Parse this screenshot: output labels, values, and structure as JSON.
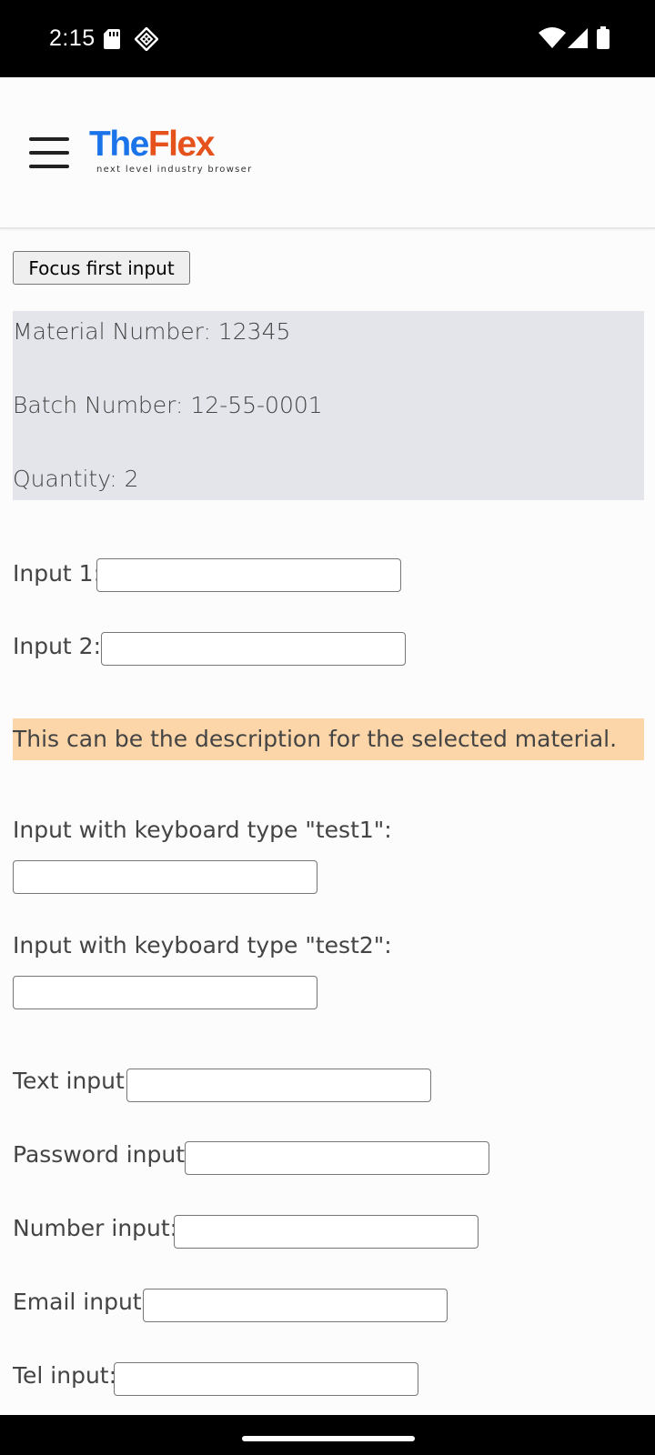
{
  "status_bar": {
    "time": "2:15",
    "icons": [
      "sd-card-icon",
      "diamond-icon",
      "wifi-icon",
      "signal-icon",
      "battery-icon"
    ]
  },
  "header": {
    "logo_part1": "The",
    "logo_part2": "Flex",
    "tagline": "next level industry browser",
    "colors": {
      "logo_blue": "#1a73e8",
      "logo_orange": "#e5521c"
    }
  },
  "main": {
    "focus_button_label": "Focus first input",
    "info": {
      "material": "Material Number: 12345",
      "batch": "Batch Number: 12-55-0001",
      "quantity": "Quantity: 2"
    },
    "input1_label": "Input 1:",
    "input2_label": "Input 2:",
    "description": "This can be the description for the selected material.",
    "kb_test1_label": "Input with keyboard type \"test1\":",
    "kb_test2_label": "Input with keyboard type \"test2\":",
    "text_label": "Text input:",
    "password_label": "Password input:",
    "number_label": "Number input:",
    "email_label": "Email input:",
    "tel_label": "Tel input:",
    "colors": {
      "info_bg": "#e4e5ea",
      "desc_bg": "#fcd6a8"
    }
  }
}
